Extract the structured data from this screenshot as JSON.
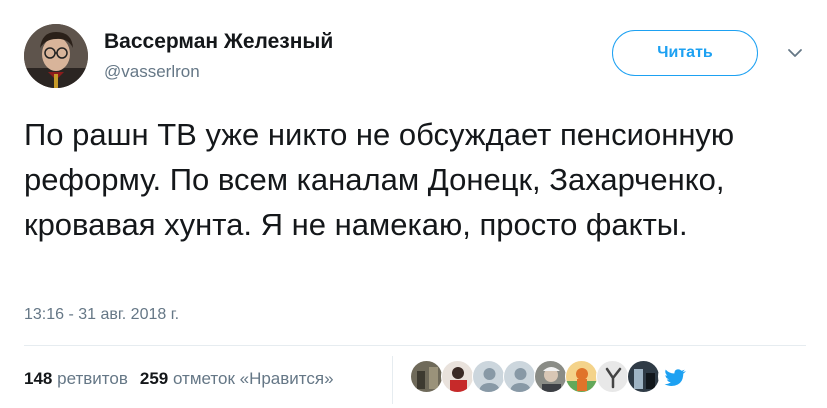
{
  "tweet": {
    "author": {
      "display_name": "Вассерман Железный",
      "handle": "@vasserlron"
    },
    "follow_label": "Читать",
    "text": "По рашн ТВ уже никто не обсуждает пенсионную реформу. По всем каналам Донецк, Захарченко, кровавая хунта. Я не намекаю, просто факты.",
    "timestamp": "13:16 - 31 авг. 2018 г.",
    "stats": {
      "retweets_count": "148",
      "retweets_label": "ретвитов",
      "likes_count": "259",
      "likes_label": "отметок «Нравится»"
    },
    "likers": [
      {
        "icon": "avatar-photo"
      },
      {
        "icon": "avatar-photo"
      },
      {
        "icon": "default-avatar-icon"
      },
      {
        "icon": "default-avatar-icon"
      },
      {
        "icon": "avatar-photo"
      },
      {
        "icon": "avatar-photo"
      },
      {
        "icon": "avatar-photo"
      },
      {
        "icon": "avatar-photo"
      },
      {
        "icon": "avatar-photo"
      }
    ]
  },
  "colors": {
    "accent": "#1da1f2",
    "text": "#14171a",
    "secondary_text": "#657786",
    "border": "#e6ecf0"
  }
}
